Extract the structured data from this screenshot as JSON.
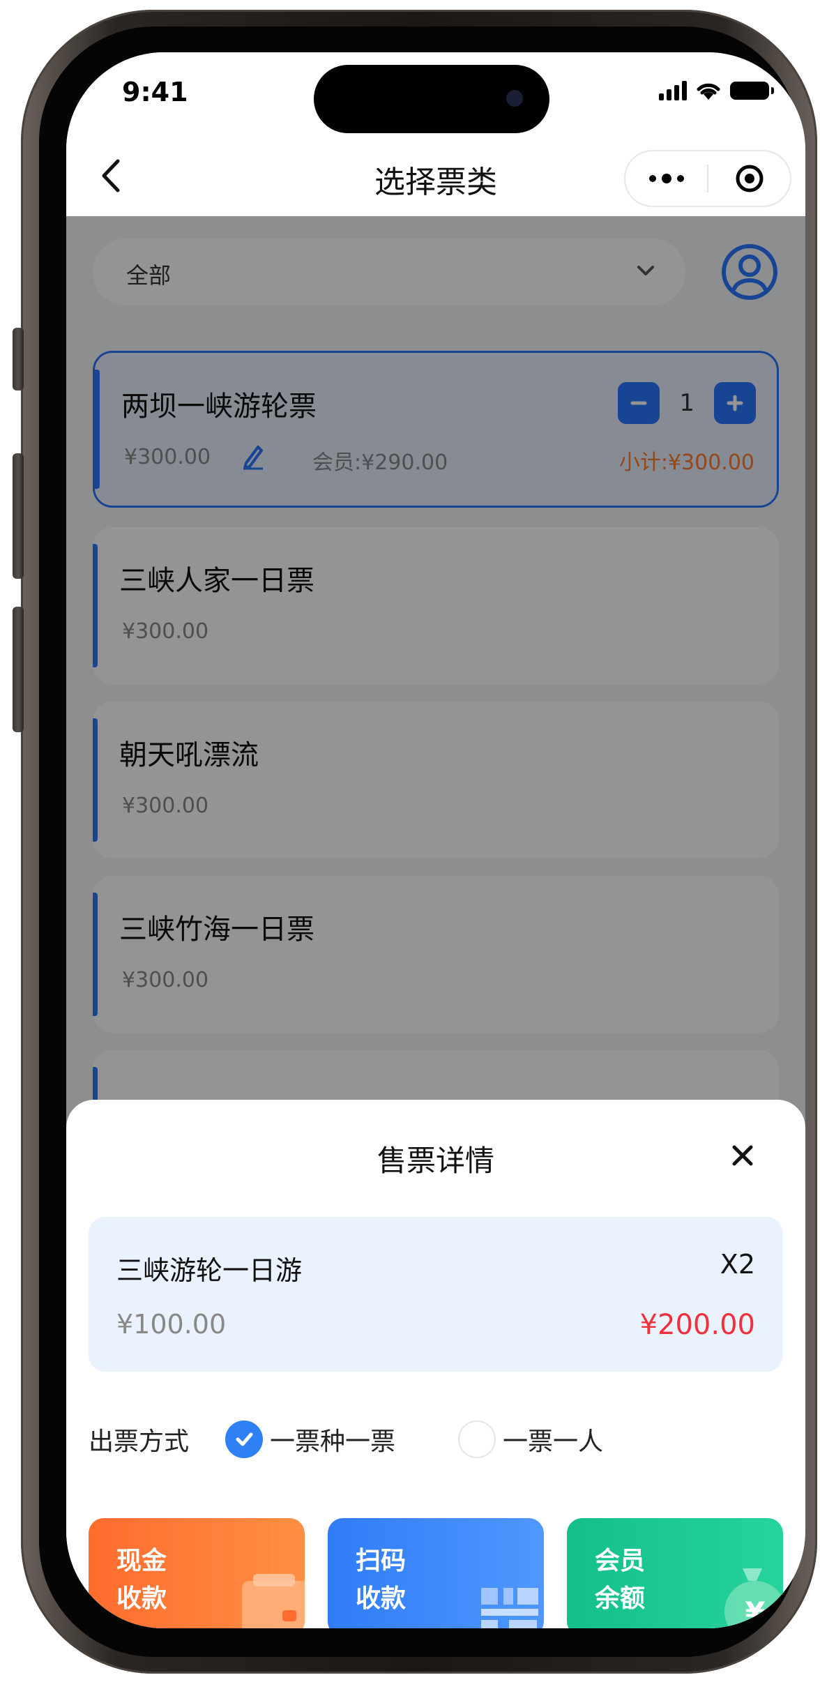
{
  "status_bar": {
    "time": "9:41"
  },
  "nav": {
    "title": "选择票类"
  },
  "filter": {
    "selected": "全部"
  },
  "tickets": [
    {
      "name": "两坝一峡游轮票",
      "price": "¥300.00",
      "member_price": "会员:¥290.00",
      "subtotal": "小计:¥300.00",
      "quantity": "1",
      "selected": true
    },
    {
      "name": "三峡人家一日票",
      "price": "¥300.00"
    },
    {
      "name": "朝天吼漂流",
      "price": "¥300.00"
    },
    {
      "name": "三峡竹海一日票",
      "price": "¥300.00"
    }
  ],
  "sheet": {
    "title": "售票详情",
    "order": {
      "name": "三峡游轮一日游",
      "qty": "X2",
      "unit_price": "¥100.00",
      "total": "¥200.00"
    },
    "issue": {
      "label": "出票方式",
      "options": [
        {
          "label": "一票种一票",
          "checked": true
        },
        {
          "label": "一票一人",
          "checked": false
        }
      ]
    },
    "payments": [
      {
        "line1": "现金",
        "line2": "收款",
        "color": "#ff7a35"
      },
      {
        "line1": "扫码",
        "line2": "收款",
        "color": "#3a86f8"
      },
      {
        "line1": "会员",
        "line2": "余额",
        "color": "#19c795"
      }
    ]
  },
  "colors": {
    "primary": "#2878ff",
    "price_red": "#f0303a",
    "subtotal_orange": "#ff7a2e"
  }
}
